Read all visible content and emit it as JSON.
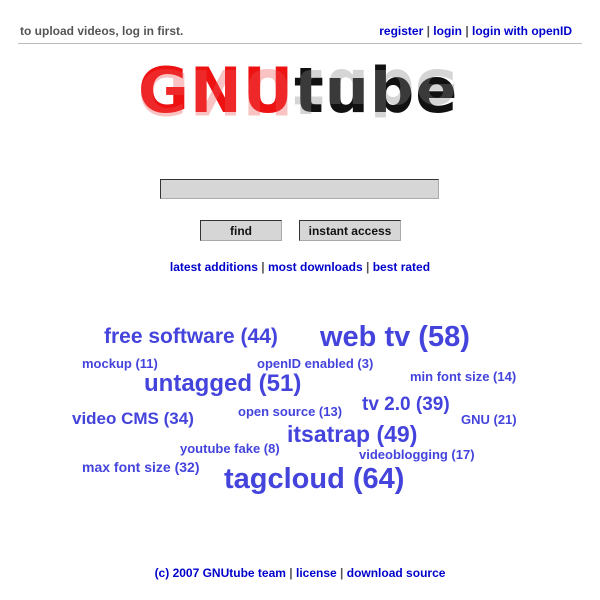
{
  "header": {
    "notice": "to upload videos, log in first.",
    "links": [
      "register",
      "login",
      "login with openID"
    ],
    "separator": "|"
  },
  "logo": {
    "part1": "GNU",
    "part2": "tube",
    "colors": {
      "gnu": "#ee1111",
      "tube": "#111111"
    }
  },
  "search": {
    "value": "",
    "find_label": "find",
    "instant_label": "instant access"
  },
  "nav": {
    "links": [
      "latest additions",
      "most downloads",
      "best rated"
    ]
  },
  "tagcloud": [
    {
      "label": "free software (44)"
    },
    {
      "label": "web tv (58)"
    },
    {
      "label": "mockup (11)"
    },
    {
      "label": "openID enabled (3)"
    },
    {
      "label": "untagged (51)"
    },
    {
      "label": "min font size (14)"
    },
    {
      "label": "video CMS (34)"
    },
    {
      "label": "open source (13)"
    },
    {
      "label": "tv 2.0 (39)"
    },
    {
      "label": "GNU (21)"
    },
    {
      "label": "itsatrap (49)"
    },
    {
      "label": "youtube fake (8)"
    },
    {
      "label": "videoblogging (17)"
    },
    {
      "label": "max font size (32)"
    },
    {
      "label": "tagcloud (64)"
    }
  ],
  "footer": {
    "links": [
      "(c) 2007 GNUtube team",
      "license",
      "download source"
    ]
  },
  "colors": {
    "link": "#0000cc",
    "tag": "#4444dd",
    "input_bg": "#d6d6d6"
  }
}
